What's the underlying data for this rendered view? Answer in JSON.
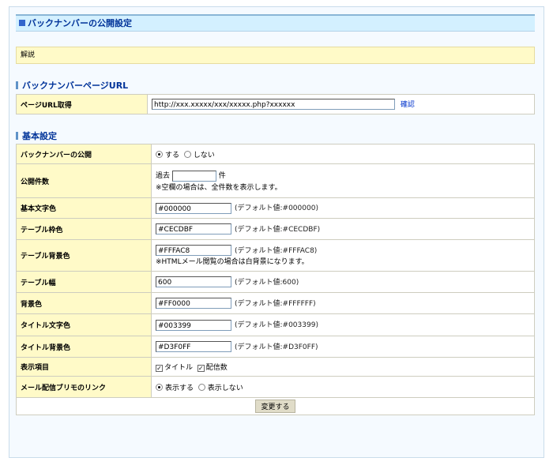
{
  "page_title": "バックナンバーの公開設定",
  "description_label": "解説",
  "url_section": {
    "heading": "バックナンバーページURL",
    "row_label": "ページURL取得",
    "url_value": "http://xxx.xxxxx/xxx/xxxxx.php?xxxxxx",
    "confirm_link": "確認"
  },
  "basic_section": {
    "heading": "基本設定",
    "publish": {
      "label": "バックナンバーの公開",
      "opt_yes": "する",
      "opt_no": "しない"
    },
    "count": {
      "label": "公開件数",
      "prefix": "過去",
      "value": "",
      "suffix": "件",
      "note": "※空欄の場合は、全件数を表示します。"
    },
    "text_color": {
      "label": "基本文字色",
      "value": "#000000",
      "hint": "(デフォルト値:#000000)"
    },
    "border_color": {
      "label": "テーブル枠色",
      "value": "#CECDBF",
      "hint": "(デフォルト値:#CECDBF)"
    },
    "table_bg": {
      "label": "テーブル背景色",
      "value": "#FFFAC8",
      "hint": "(デフォルト値:#FFFAC8)",
      "note": "※HTMLメール閲覧の場合は白背景になります。"
    },
    "table_width": {
      "label": "テーブル幅",
      "value": "600",
      "hint": "(デフォルト値:600)"
    },
    "bg_color": {
      "label": "背景色",
      "value": "#FF0000",
      "hint": "(デフォルト値:#FFFFFF)"
    },
    "title_color": {
      "label": "タイトル文字色",
      "value": "#003399",
      "hint": "(デフォルト値:#003399)"
    },
    "title_bg": {
      "label": "タイトル背景色",
      "value": "#D3F0FF",
      "hint": "(デフォルト値:#D3F0FF)"
    },
    "display_items": {
      "label": "表示項目",
      "opt_title": "タイトル",
      "opt_count": "配信数"
    },
    "link": {
      "label": "メール配信ブリモのリンク",
      "opt_show": "表示する",
      "opt_hide": "表示しない"
    },
    "submit": "変更する"
  }
}
